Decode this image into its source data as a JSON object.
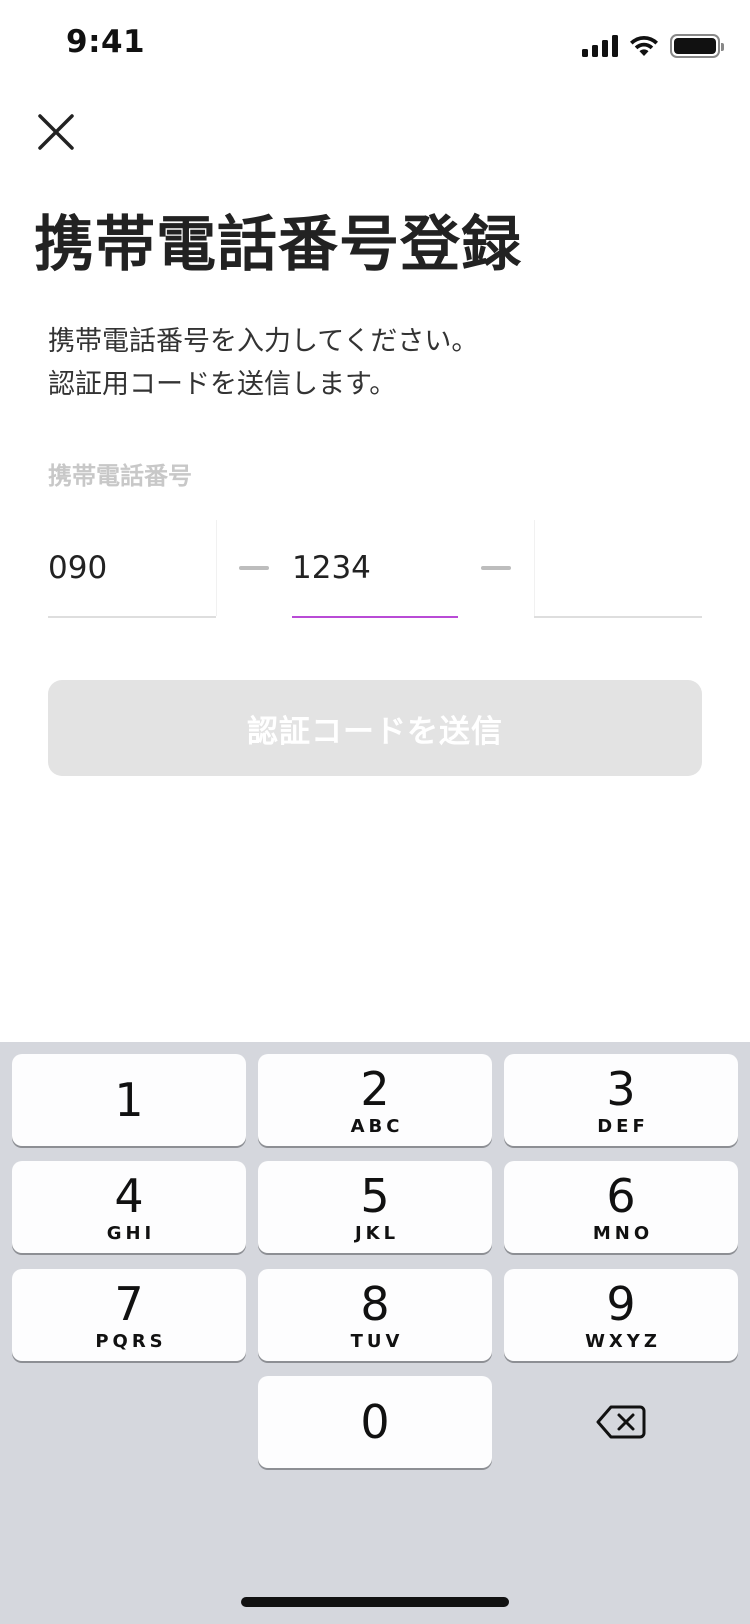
{
  "status_bar": {
    "time": "9:41",
    "signal_icon": "cellular-signal-icon",
    "wifi_icon": "wifi-icon",
    "battery_icon": "battery-icon",
    "battery_level": 1.0
  },
  "header": {
    "close_icon": "close-icon",
    "title": "携帯電話番号登録"
  },
  "description": {
    "line1": "携帯電話番号を入力してください。",
    "line2": "認証用コードを送信します。"
  },
  "form": {
    "label": "携帯電話番号",
    "field1": {
      "value": "090",
      "placeholder": ""
    },
    "field2": {
      "value": "1234",
      "placeholder": ""
    },
    "field3": {
      "value": "",
      "placeholder": ""
    },
    "submit_label": "認証コードを送信"
  },
  "colors": {
    "accent": "#b94bd6",
    "disabled_button": "#e3e3e3",
    "keyboard_bg": "#d5d7dd"
  },
  "keyboard": {
    "keys": [
      {
        "num": "1",
        "letters": ""
      },
      {
        "num": "2",
        "letters": "ABC"
      },
      {
        "num": "3",
        "letters": "DEF"
      },
      {
        "num": "4",
        "letters": "GHI"
      },
      {
        "num": "5",
        "letters": "JKL"
      },
      {
        "num": "6",
        "letters": "MNO"
      },
      {
        "num": "7",
        "letters": "PQRS"
      },
      {
        "num": "8",
        "letters": "TUV"
      },
      {
        "num": "9",
        "letters": "WXYZ"
      },
      {
        "num": "0",
        "letters": ""
      }
    ],
    "delete_icon": "backspace-icon"
  }
}
